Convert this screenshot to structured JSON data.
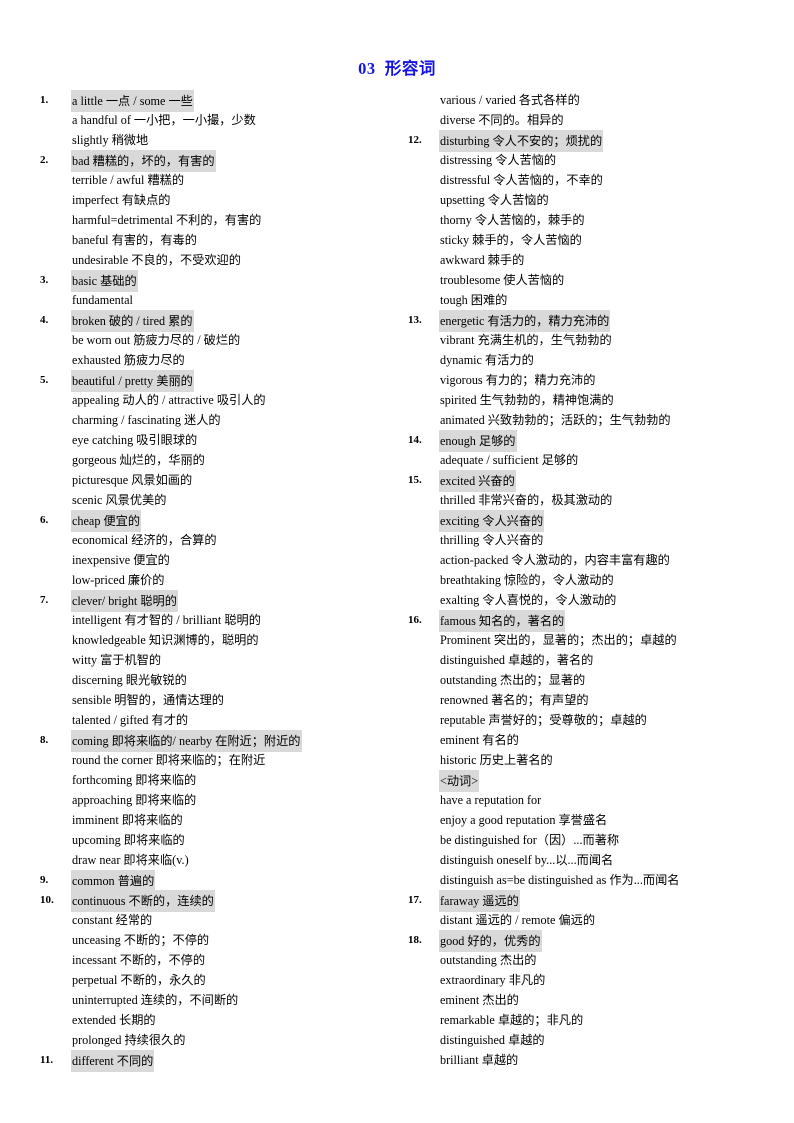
{
  "title": "03  形容词",
  "title_color": "#1414e6",
  "highlight_color": "#d9d9d9",
  "columns": {
    "left": [
      {
        "num": "1.",
        "highlight": true,
        "text": "a little  一点 / some 一些"
      },
      {
        "num": "",
        "highlight": false,
        "text": "a handful of 一小把，一小撮，少数"
      },
      {
        "num": "",
        "highlight": false,
        "text": "slightly 稍微地"
      },
      {
        "num": "2.",
        "highlight": true,
        "text": "bad 糟糕的，坏的，有害的"
      },
      {
        "num": "",
        "highlight": false,
        "text": "terrible / awful 糟糕的"
      },
      {
        "num": "",
        "highlight": false,
        "text": "imperfect 有缺点的"
      },
      {
        "num": "",
        "highlight": false,
        "text": "harmful=detrimental 不利的，有害的"
      },
      {
        "num": "",
        "highlight": false,
        "text": "baneful 有害的，有毒的"
      },
      {
        "num": "",
        "highlight": false,
        "text": "undesirable 不良的，不受欢迎的"
      },
      {
        "num": "3.",
        "highlight": true,
        "text": "basic 基础的"
      },
      {
        "num": "",
        "highlight": false,
        "text": "fundamental"
      },
      {
        "num": "4.",
        "highlight": true,
        "text": "broken 破的 / tired 累的"
      },
      {
        "num": "",
        "highlight": false,
        "text": "be worn out 筋疲力尽的 / 破烂的"
      },
      {
        "num": "",
        "highlight": false,
        "text": "exhausted 筋疲力尽的"
      },
      {
        "num": "5.",
        "highlight": true,
        "text": "beautiful / pretty 美丽的"
      },
      {
        "num": "",
        "highlight": false,
        "text": "appealing 动人的 / attractive 吸引人的"
      },
      {
        "num": "",
        "highlight": false,
        "text": "charming / fascinating 迷人的"
      },
      {
        "num": "",
        "highlight": false,
        "text": "eye catching 吸引眼球的"
      },
      {
        "num": "",
        "highlight": false,
        "text": "gorgeous 灿烂的，华丽的"
      },
      {
        "num": "",
        "highlight": false,
        "text": "picturesque 风景如画的"
      },
      {
        "num": "",
        "highlight": false,
        "text": "scenic 风景优美的"
      },
      {
        "num": "6.",
        "highlight": true,
        "text": "cheap 便宜的"
      },
      {
        "num": "",
        "highlight": false,
        "text": "economical 经济的，合算的"
      },
      {
        "num": "",
        "highlight": false,
        "text": "inexpensive 便宜的"
      },
      {
        "num": "",
        "highlight": false,
        "text": "low-priced 廉价的"
      },
      {
        "num": "7.",
        "highlight": true,
        "text": "clever/ bright  聪明的"
      },
      {
        "num": "",
        "highlight": false,
        "text": "intelligent  有才智的 / brilliant  聪明的"
      },
      {
        "num": "",
        "highlight": false,
        "text": "knowledgeable 知识渊博的，聪明的"
      },
      {
        "num": "",
        "highlight": false,
        "text": "witty 富于机智的"
      },
      {
        "num": "",
        "highlight": false,
        "text": "discerning 眼光敏锐的"
      },
      {
        "num": "",
        "highlight": false,
        "text": "sensible 明智的，通情达理的"
      },
      {
        "num": "",
        "highlight": false,
        "text": "talented / gifted 有才的"
      },
      {
        "num": "8.",
        "highlight": true,
        "text": "coming  即将来临的/ nearby 在附近；附近的"
      },
      {
        "num": "",
        "highlight": false,
        "text": "round the corner 即将来临的；在附近"
      },
      {
        "num": "",
        "highlight": false,
        "text": "forthcoming 即将来临的"
      },
      {
        "num": "",
        "highlight": false,
        "text": "approaching 即将来临的"
      },
      {
        "num": "",
        "highlight": false,
        "text": "imminent 即将来临的"
      },
      {
        "num": "",
        "highlight": false,
        "text": "upcoming 即将来临的"
      },
      {
        "num": "",
        "highlight": false,
        "text": "draw near 即将来临(v.)"
      },
      {
        "num": "9.",
        "highlight": true,
        "text": "common  普遍的"
      },
      {
        "num": "10.",
        "highlight": true,
        "text": "continuous 不断的，连续的"
      },
      {
        "num": "",
        "highlight": false,
        "text": "constant 经常的"
      },
      {
        "num": "",
        "highlight": false,
        "text": "unceasing 不断的；不停的"
      },
      {
        "num": "",
        "highlight": false,
        "text": "incessant 不断的，不停的"
      },
      {
        "num": "",
        "highlight": false,
        "text": "perpetual 不断的，永久的"
      },
      {
        "num": "",
        "highlight": false,
        "text": "uninterrupted 连续的，不间断的"
      },
      {
        "num": "",
        "highlight": false,
        "text": "extended 长期的"
      },
      {
        "num": "",
        "highlight": false,
        "text": "prolonged 持续很久的"
      },
      {
        "num": "11.",
        "highlight": true,
        "text": "different 不同的"
      }
    ],
    "right": [
      {
        "num": "",
        "highlight": false,
        "text": "various / varied 各式各样的"
      },
      {
        "num": "",
        "highlight": false,
        "text": "diverse 不同的。相异的"
      },
      {
        "num": "12.",
        "highlight": true,
        "text": "disturbing 令人不安的；烦扰的"
      },
      {
        "num": "",
        "highlight": false,
        "text": "distressing 令人苦恼的"
      },
      {
        "num": "",
        "highlight": false,
        "text": "distressful 令人苦恼的，不幸的"
      },
      {
        "num": "",
        "highlight": false,
        "text": "upsetting 令人苦恼的"
      },
      {
        "num": "",
        "highlight": false,
        "text": "thorny 令人苦恼的，棘手的"
      },
      {
        "num": "",
        "highlight": false,
        "text": "sticky 棘手的，令人苦恼的"
      },
      {
        "num": "",
        "highlight": false,
        "text": "awkward 棘手的"
      },
      {
        "num": "",
        "highlight": false,
        "text": "troublesome 使人苦恼的"
      },
      {
        "num": "",
        "highlight": false,
        "text": "tough 困难的"
      },
      {
        "num": "13.",
        "highlight": true,
        "text": "energetic 有活力的，精力充沛的"
      },
      {
        "num": "",
        "highlight": false,
        "text": "vibrant 充满生机的，生气勃勃的"
      },
      {
        "num": "",
        "highlight": false,
        "text": "dynamic 有活力的"
      },
      {
        "num": "",
        "highlight": false,
        "text": "vigorous 有力的；精力充沛的"
      },
      {
        "num": "",
        "highlight": false,
        "text": "spirited 生气勃勃的，精神饱满的"
      },
      {
        "num": "",
        "highlight": false,
        "text": "animated 兴致勃勃的；活跃的；生气勃勃的"
      },
      {
        "num": "14.",
        "highlight": true,
        "text": "enough  足够的"
      },
      {
        "num": "",
        "highlight": false,
        "text": "adequate / sufficient 足够的"
      },
      {
        "num": "15.",
        "highlight": true,
        "text": "excited  兴奋的"
      },
      {
        "num": "",
        "highlight": false,
        "text": "thrilled  非常兴奋的，极其激动的"
      },
      {
        "num": "",
        "highlight": true,
        "text": "exciting 令人兴奋的"
      },
      {
        "num": "",
        "highlight": false,
        "text": "thrilling  令人兴奋的"
      },
      {
        "num": "",
        "highlight": false,
        "text": "action-packed 令人激动的，内容丰富有趣的"
      },
      {
        "num": "",
        "highlight": false,
        "text": "breathtaking 惊险的，令人激动的"
      },
      {
        "num": "",
        "highlight": false,
        "text": "exalting 令人喜悦的，令人激动的"
      },
      {
        "num": "16.",
        "highlight": true,
        "text": "famous 知名的，著名的"
      },
      {
        "num": "",
        "highlight": false,
        "text": "Prominent  突出的，显著的；杰出的；卓越的"
      },
      {
        "num": "",
        "highlight": false,
        "text": "distinguished 卓越的，著名的"
      },
      {
        "num": "",
        "highlight": false,
        "text": "outstanding 杰出的；显著的"
      },
      {
        "num": "",
        "highlight": false,
        "text": "renowned 著名的；有声望的"
      },
      {
        "num": "",
        "highlight": false,
        "text": "reputable  声誉好的；受尊敬的；卓越的"
      },
      {
        "num": "",
        "highlight": false,
        "text": "eminent 有名的"
      },
      {
        "num": "",
        "highlight": false,
        "text": "historic 历史上著名的"
      },
      {
        "num": "",
        "highlight": true,
        "text": "<动词>"
      },
      {
        "num": "",
        "highlight": false,
        "text": "have a reputation  for"
      },
      {
        "num": "",
        "highlight": false,
        "text": "enjoy a good reputation 享誉盛名"
      },
      {
        "num": "",
        "highlight": false,
        "text": "be distinguished for（因）...而著称"
      },
      {
        "num": "",
        "highlight": false,
        "text": "distinguish oneself by...以...而闻名"
      },
      {
        "num": "",
        "highlight": false,
        "text": "distinguish as=be distinguished as 作为...而闻名"
      },
      {
        "num": "17.",
        "highlight": true,
        "text": "faraway 遥远的"
      },
      {
        "num": "",
        "highlight": false,
        "text": "distant  遥远的 / remote  偏远的"
      },
      {
        "num": "18.",
        "highlight": true,
        "text": "good 好的，优秀的"
      },
      {
        "num": "",
        "highlight": false,
        "text": "outstanding  杰出的"
      },
      {
        "num": "",
        "highlight": false,
        "text": "extraordinary  非凡的"
      },
      {
        "num": "",
        "highlight": false,
        "text": "eminent 杰出的"
      },
      {
        "num": "",
        "highlight": false,
        "text": "remarkable 卓越的；非凡的"
      },
      {
        "num": "",
        "highlight": false,
        "text": "distinguished  卓越的"
      },
      {
        "num": "",
        "highlight": false,
        "text": "brilliant  卓越的"
      }
    ]
  }
}
